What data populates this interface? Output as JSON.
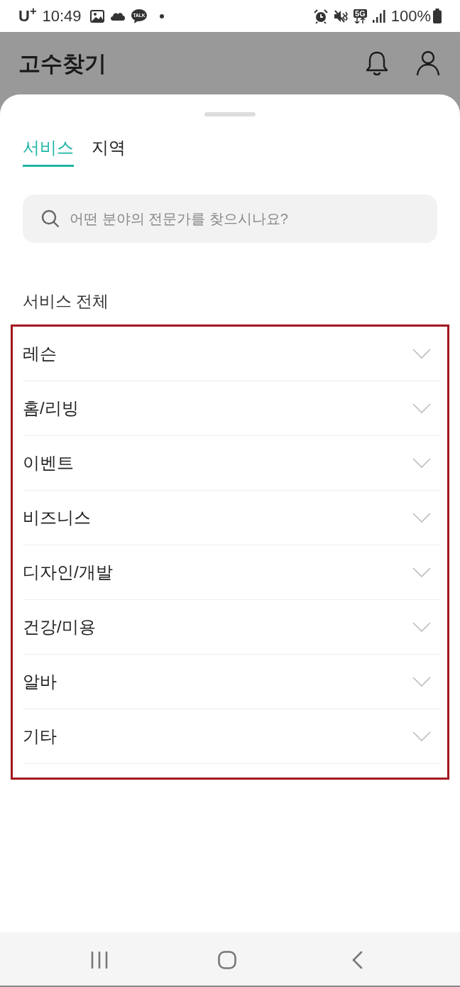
{
  "status_bar": {
    "carrier": "U$^{+}$",
    "time": "10:49",
    "chat_badge": "TALK",
    "network": "5G",
    "battery": "100%"
  },
  "header": {
    "title": "고수찾기"
  },
  "tabs": [
    {
      "label": "서비스",
      "selected": true
    },
    {
      "label": "지역",
      "selected": false
    }
  ],
  "search": {
    "placeholder": "어떤 분야의 전문가를 찾으시나요?"
  },
  "section_title": "서비스 전체",
  "categories_highlighted": true,
  "categories": [
    {
      "label": "레슨",
      "expanded": false
    },
    {
      "label": "홈/리빙",
      "expanded": false
    },
    {
      "label": "이벤트",
      "expanded": false
    },
    {
      "label": "비즈니스",
      "expanded": false
    },
    {
      "label": "디자인/개발",
      "expanded": false
    },
    {
      "label": "건강/미용",
      "expanded": false
    },
    {
      "label": "알바",
      "expanded": false
    },
    {
      "label": "기타",
      "expanded": false
    }
  ]
}
